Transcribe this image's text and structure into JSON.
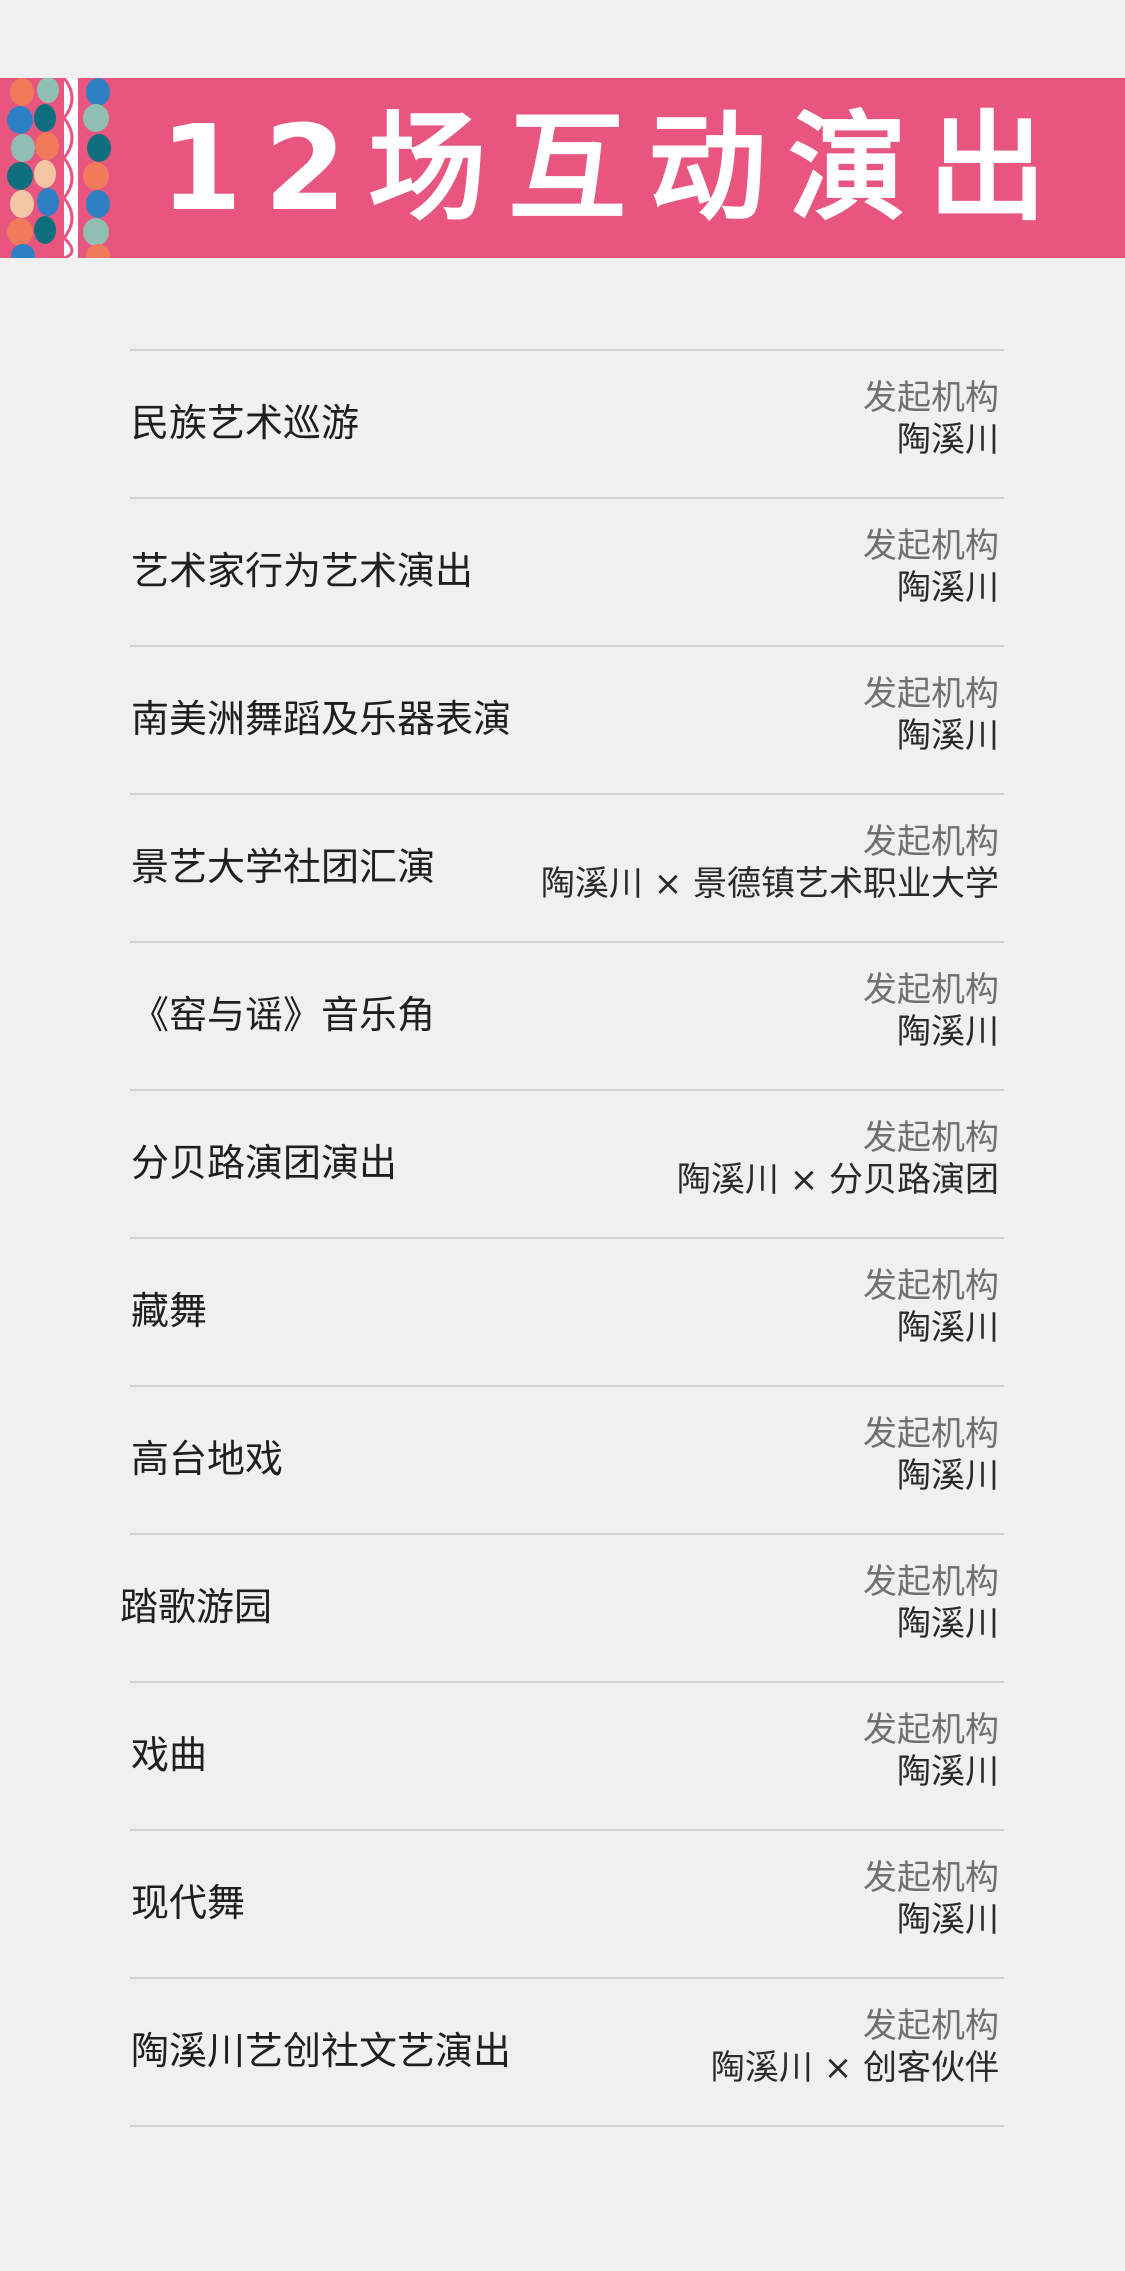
{
  "header": {
    "title": "12场互动演出",
    "colors": {
      "banner": "#e8567f",
      "title_text": "#ffffff",
      "deco": [
        "#f07a5a",
        "#2f7fc4",
        "#8fbfb3",
        "#0f6e7e",
        "#f2c6a5",
        "#ffffff"
      ]
    },
    "decoration_icon": "woven-pattern-icon"
  },
  "events": [
    {
      "name": "民族艺术巡游",
      "org_label": "发起机构",
      "org": "陶溪川"
    },
    {
      "name": "艺术家行为艺术演出",
      "org_label": "发起机构",
      "org": "陶溪川"
    },
    {
      "name": "南美洲舞蹈及乐器表演",
      "org_label": "发起机构",
      "org": "陶溪川"
    },
    {
      "name": "景艺大学社团汇演",
      "org_label": "发起机构",
      "org": "陶溪川 × 景德镇艺术职业大学"
    },
    {
      "name": "《窑与谣》音乐角",
      "org_label": "发起机构",
      "org": "陶溪川"
    },
    {
      "name": "分贝路演团演出",
      "org_label": "发起机构",
      "org": "陶溪川 × 分贝路演团"
    },
    {
      "name": "藏舞",
      "org_label": "发起机构",
      "org": "陶溪川"
    },
    {
      "name": "高台地戏",
      "org_label": "发起机构",
      "org": "陶溪川"
    },
    {
      "name": "踏歌游园",
      "org_label": "发起机构",
      "org": "陶溪川"
    },
    {
      "name": "戏曲",
      "org_label": "发起机构",
      "org": "陶溪川"
    },
    {
      "name": "现代舞",
      "org_label": "发起机构",
      "org": "陶溪川"
    },
    {
      "name": "陶溪川艺创社文艺演出",
      "org_label": "发起机构",
      "org": "陶溪川 × 创客伙伴"
    }
  ]
}
